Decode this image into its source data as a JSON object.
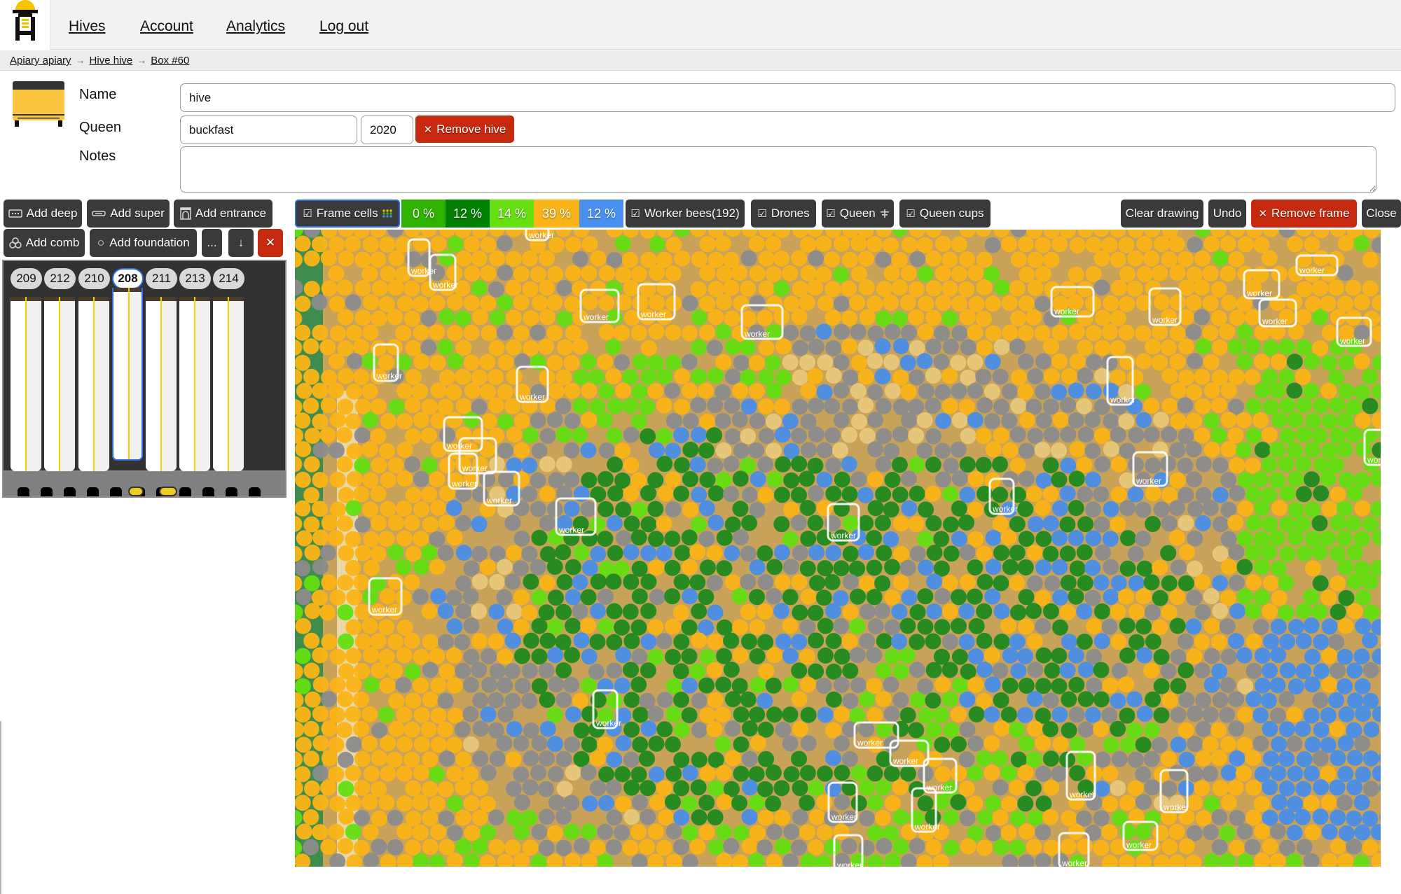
{
  "nav": {
    "logo": "hive-logo-icon",
    "links": [
      "Hives",
      "Account",
      "Analytics",
      "Log out"
    ]
  },
  "breadcrumb": {
    "items": [
      "Apiary apiary",
      "Hive hive",
      "Box #60"
    ],
    "separator": "→"
  },
  "hive": {
    "name_label": "Name",
    "name_value": "hive",
    "queen_label": "Queen",
    "queen_race": "buckfast",
    "queen_year": "2020",
    "notes_label": "Notes",
    "notes_value": "",
    "remove_hive_label": "Remove hive"
  },
  "box_toolbar": {
    "add_deep": "Add deep",
    "add_super": "Add super",
    "add_entrance": "Add entrance",
    "add_comb": "Add comb",
    "add_foundation": "Add foundation",
    "more": "...",
    "move_down": "↓",
    "remove": "✕"
  },
  "frames": {
    "tabs": [
      "209",
      "212",
      "210",
      "208",
      "211",
      "213",
      "214"
    ],
    "active_index": 3,
    "entrance_holes": 11
  },
  "frame_toolbar": {
    "frame_cells_label": "Frame cells",
    "frame_cells_checked": true,
    "percentages": [
      {
        "value": "0 %",
        "color": "#2eb300",
        "kind": "brood"
      },
      {
        "value": "12 %",
        "color": "#008000",
        "kind": "capped-brood"
      },
      {
        "value": "14 %",
        "color": "#66e010",
        "kind": "eggs"
      },
      {
        "value": "39 %",
        "color": "#fbb417",
        "kind": "pollen-honey"
      },
      {
        "value": "12 %",
        "color": "#4a90f0",
        "kind": "nectar"
      }
    ],
    "worker_bees_label": "Worker bees(192)",
    "worker_bees_checked": true,
    "drones_label": "Drones",
    "drones_checked": true,
    "queen_label": "Queen",
    "queen_checked": true,
    "queen_cups_label": "Queen cups",
    "queen_cups_checked": true,
    "clear_drawing": "Clear drawing",
    "undo": "Undo",
    "remove_frame": "Remove frame",
    "close": "Close"
  },
  "frame_view": {
    "detection_label": "worker",
    "cell_colors": {
      "honey": "#fbb417",
      "capped_brood": "#1f8a1f",
      "eggs": "#62df12",
      "nectar": "#4a8ee8",
      "empty": "#8c8c8c",
      "pollen": "#e8c87a"
    }
  }
}
